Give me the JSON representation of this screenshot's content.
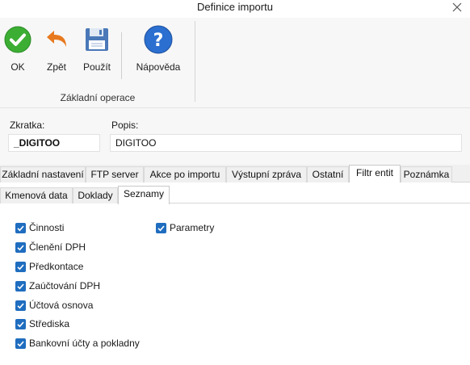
{
  "window": {
    "title": "Definice importu"
  },
  "ribbon": {
    "buttons": [
      {
        "label": "OK"
      },
      {
        "label": "Zpět"
      },
      {
        "label": "Použít"
      },
      {
        "label": "Nápověda"
      }
    ],
    "group_label": "Základní operace"
  },
  "fields": {
    "zkratka_label": "Zkratka:",
    "zkratka_value": "_DIGITOO",
    "popis_label": "Popis:",
    "popis_value": "DIGITOO"
  },
  "main_tabs": [
    {
      "label": "Základní nastavení"
    },
    {
      "label": "FTP server"
    },
    {
      "label": "Akce po importu"
    },
    {
      "label": "Výstupní zpráva"
    },
    {
      "label": "Ostatní"
    },
    {
      "label": "Filtr entit",
      "active": true
    },
    {
      "label": "Poznámka"
    }
  ],
  "sub_tabs": [
    {
      "label": "Kmenová data"
    },
    {
      "label": "Doklady"
    },
    {
      "label": "Seznamy",
      "active": true
    }
  ],
  "checkboxes_left": [
    {
      "label": "Činnosti",
      "checked": true
    },
    {
      "label": "Členění DPH",
      "checked": true
    },
    {
      "label": "Předkontace",
      "checked": true
    },
    {
      "label": "Zaúčtování DPH",
      "checked": true
    },
    {
      "label": "Účtová osnova",
      "checked": true
    },
    {
      "label": "Střediska",
      "checked": true
    },
    {
      "label": "Bankovní účty a pokladny",
      "checked": true
    }
  ],
  "checkboxes_right": [
    {
      "label": "Parametry",
      "checked": true
    }
  ],
  "colors": {
    "accent": "#1f6dbf",
    "ok_green": "#3cae34",
    "undo_orange": "#e8791e",
    "help_blue": "#2b6fd0"
  }
}
